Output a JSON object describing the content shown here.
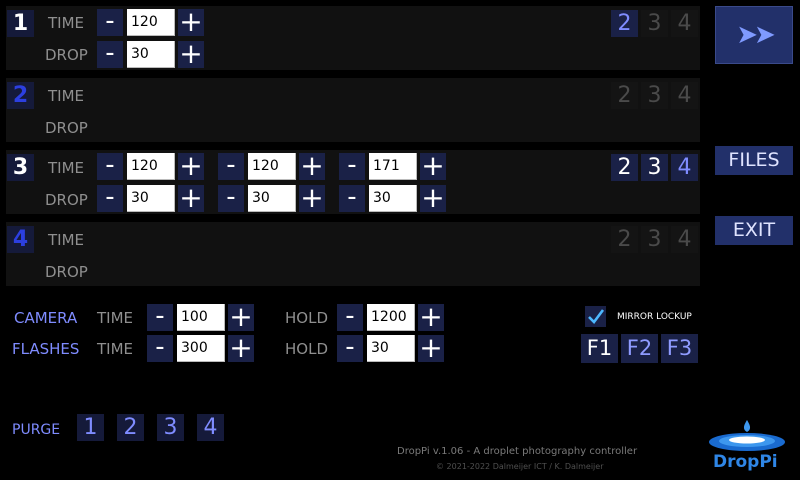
{
  "labels": {
    "time": "TIME",
    "drop": "DROP",
    "camera": "CAMERA",
    "flashes": "FLASHES",
    "hold": "HOLD",
    "purge": "PURGE",
    "mirror_lockup": "MIRROR LOCKUP"
  },
  "buttons": {
    "minus": "-",
    "plus": "+",
    "run": "➤➤",
    "files": "FILES",
    "exit": "EXIT"
  },
  "valves": [
    {
      "number": "1",
      "time": [
        "120"
      ],
      "drop": [
        "30"
      ],
      "drops_selected": [
        "2",
        "3",
        "4"
      ],
      "drops_active": [
        true,
        false,
        false
      ]
    },
    {
      "number": "2",
      "time": [],
      "drop": [],
      "drops_selected": [
        "2",
        "3",
        "4"
      ],
      "drops_active": [
        false,
        false,
        false
      ]
    },
    {
      "number": "3",
      "time": [
        "120",
        "120",
        "171"
      ],
      "drop": [
        "30",
        "30",
        "30"
      ],
      "drops_selected": [
        "2",
        "3",
        "4"
      ],
      "drops_active": [
        true,
        true,
        true
      ]
    },
    {
      "number": "4",
      "time": [],
      "drop": [],
      "drops_selected": [
        "2",
        "3",
        "4"
      ],
      "drops_active": [
        false,
        false,
        false
      ]
    }
  ],
  "camera": {
    "time": "100",
    "hold": "1200"
  },
  "flashes": {
    "time": "300",
    "hold": "30"
  },
  "mirror_lockup_checked": true,
  "flash_buttons": [
    "F1",
    "F2",
    "F3"
  ],
  "purge_buttons": [
    "1",
    "2",
    "3",
    "4"
  ],
  "footer": {
    "title": "DropPi v.1.06 - A droplet photography controller",
    "copyright": "© 2021-2022 Dalmeijer ICT / K. Dalmeijer"
  },
  "logo": {
    "text": "DropPi"
  },
  "colors": {
    "accent": "#7f8cff",
    "button": "#1a2147",
    "side_button": "#22306a",
    "panel": "#111111"
  }
}
